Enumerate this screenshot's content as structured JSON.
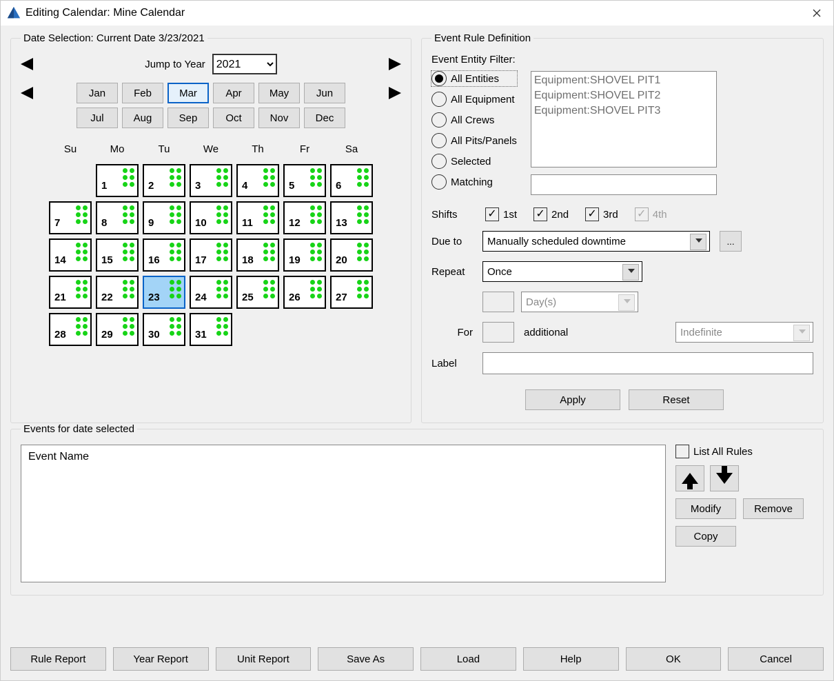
{
  "window": {
    "title": "Editing Calendar: Mine Calendar"
  },
  "dateSelection": {
    "legend": "Date Selection: Current Date 3/23/2021",
    "jumpLabel": "Jump to Year",
    "year": "2021",
    "months": [
      "Jan",
      "Feb",
      "Mar",
      "Apr",
      "May",
      "Jun",
      "Jul",
      "Aug",
      "Sep",
      "Oct",
      "Nov",
      "Dec"
    ],
    "selectedMonthIndex": 2,
    "dow": [
      "Su",
      "Mo",
      "Tu",
      "We",
      "Th",
      "Fr",
      "Sa"
    ],
    "firstDayIndex": 1,
    "daysInMonth": 31,
    "today": 23
  },
  "eventRule": {
    "legend": "Event Rule Definition",
    "filterLabel": "Event Entity Filter:",
    "radios": [
      "All Entities",
      "All Equipment",
      "All Crews",
      "All Pits/Panels",
      "Selected",
      "Matching"
    ],
    "selectedRadio": 0,
    "entities": [
      "Equipment:SHOVEL PIT1",
      "Equipment:SHOVEL PIT2",
      "Equipment:SHOVEL PIT3"
    ],
    "shiftsLabel": "Shifts",
    "shifts": [
      {
        "label": "1st",
        "checked": true,
        "disabled": false
      },
      {
        "label": "2nd",
        "checked": true,
        "disabled": false
      },
      {
        "label": "3rd",
        "checked": true,
        "disabled": false
      },
      {
        "label": "4th",
        "checked": true,
        "disabled": true
      }
    ],
    "dueToLabel": "Due to",
    "dueToValue": "Manually scheduled downtime",
    "repeatLabel": "Repeat",
    "repeatValue": "Once",
    "daysValue": "Day(s)",
    "forLabel": "For",
    "additionalLabel": "additional",
    "indefiniteValue": "Indefinite",
    "labelLabel": "Label",
    "applyLabel": "Apply",
    "resetLabel": "Reset"
  },
  "events": {
    "legend": "Events for date selected",
    "header": "Event Name",
    "listAll": "List All Rules",
    "modify": "Modify",
    "remove": "Remove",
    "copy": "Copy"
  },
  "bottom": {
    "ruleReport": "Rule Report",
    "yearReport": "Year Report",
    "unitReport": "Unit Report",
    "saveAs": "Save As",
    "load": "Load",
    "help": "Help",
    "ok": "OK",
    "cancel": "Cancel"
  }
}
